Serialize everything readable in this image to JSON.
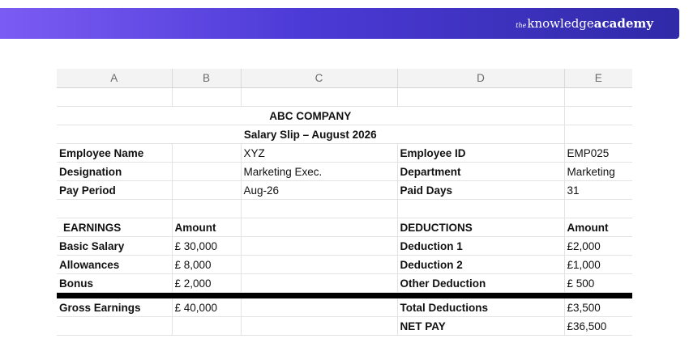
{
  "brand": {
    "the": "the",
    "knowledge": "knowledge",
    "academy": "academy"
  },
  "columns": [
    "A",
    "B",
    "C",
    "D",
    "E"
  ],
  "company": "ABC COMPANY",
  "slip_title": "Salary Slip – August 2026",
  "employee": {
    "name_label": "Employee Name",
    "name": "XYZ",
    "id_label": "Employee ID",
    "id": "EMP025",
    "designation_label": "Designation",
    "designation": "Marketing Exec.",
    "department_label": "Department",
    "department": "Marketing",
    "pay_period_label": "Pay Period",
    "pay_period": "Aug-26",
    "paid_days_label": "Paid Days",
    "paid_days": "31"
  },
  "earnings": {
    "header": "EARNINGS",
    "amount_header": "Amount",
    "items": [
      {
        "label": "Basic Salary",
        "amount": "£ 30,000"
      },
      {
        "label": "Allowances",
        "amount": "£ 8,000"
      },
      {
        "label": "Bonus",
        "amount": "£ 2,000"
      }
    ],
    "gross_label": "Gross Earnings",
    "gross": "£ 40,000"
  },
  "deductions": {
    "header": "DEDUCTIONS",
    "amount_header": "Amount",
    "items": [
      {
        "label": "Deduction 1",
        "amount": "£2,000"
      },
      {
        "label": "Deduction 2",
        "amount": "£1,000"
      },
      {
        "label": "Other  Deduction",
        "amount": "£ 500"
      }
    ],
    "total_label": "Total Deductions",
    "total": "£3,500"
  },
  "net_pay": {
    "label": "NET PAY",
    "value": "£36,500"
  }
}
